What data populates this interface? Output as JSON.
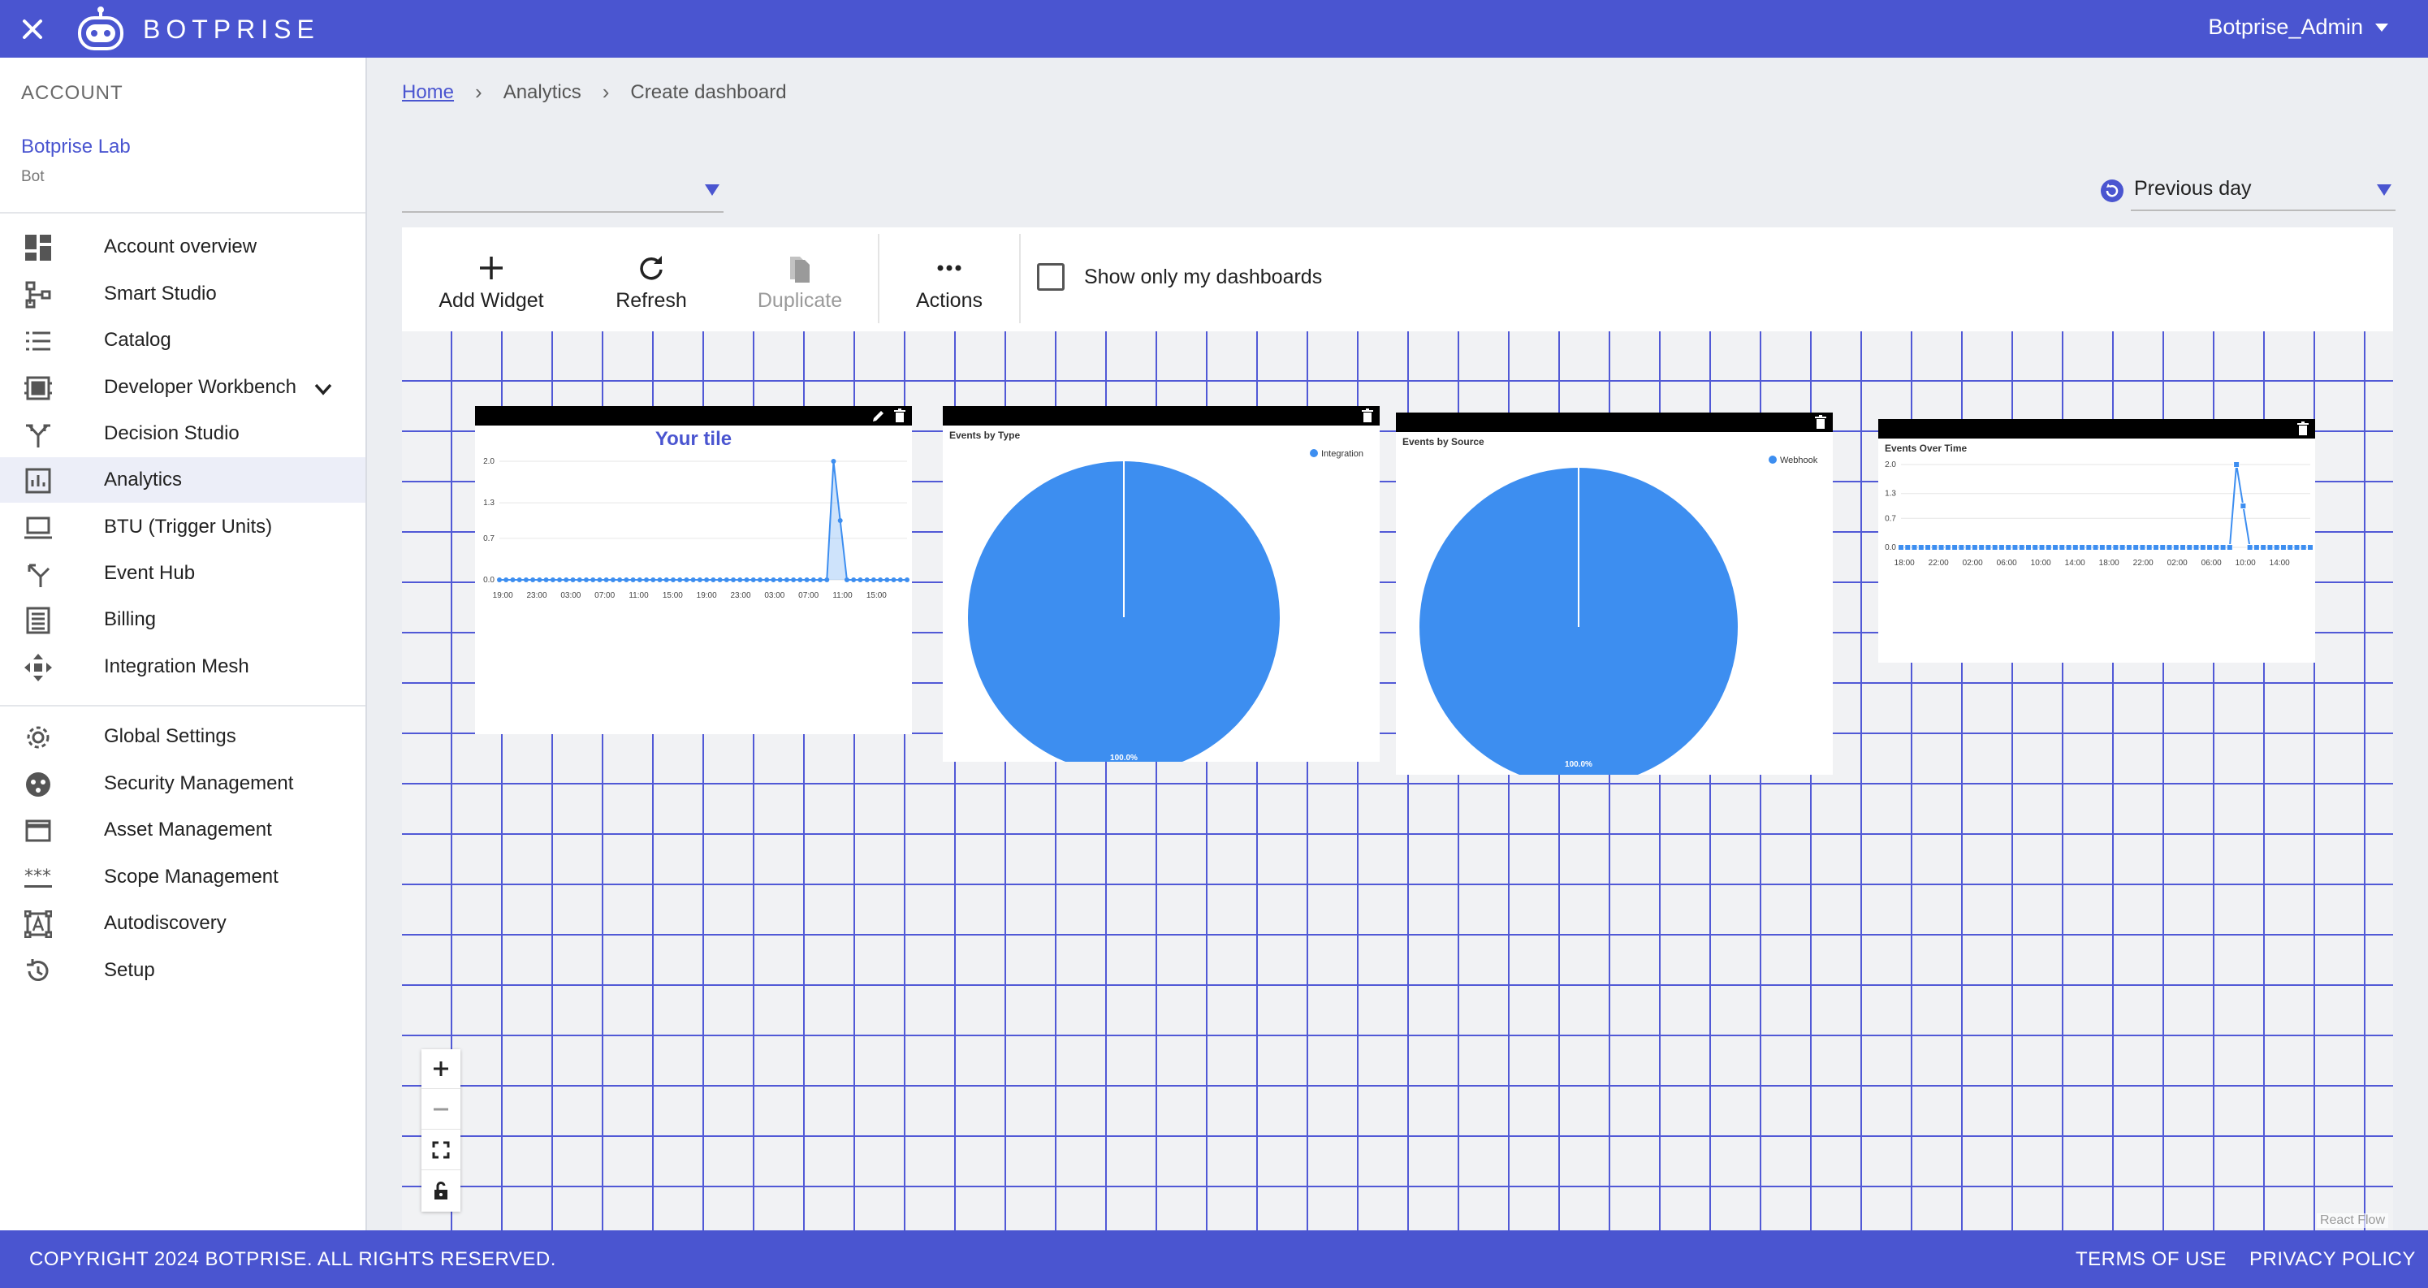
{
  "header": {
    "brand": "BOTPRISE",
    "user": "Botprise_Admin"
  },
  "sidebar": {
    "section_label": "ACCOUNT",
    "account_name": "Botprise Lab",
    "account_type": "Bot",
    "items": [
      {
        "label": "Account overview",
        "icon": "dashboard-icon"
      },
      {
        "label": "Smart Studio",
        "icon": "workflow-icon"
      },
      {
        "label": "Catalog",
        "icon": "list-icon"
      },
      {
        "label": "Developer Workbench",
        "icon": "workbench-icon"
      },
      {
        "label": "Decision Studio",
        "icon": "fork-icon"
      },
      {
        "label": "Analytics",
        "icon": "bar-chart-icon"
      },
      {
        "label": "BTU (Trigger Units)",
        "icon": "laptop-icon"
      },
      {
        "label": "Event Hub",
        "icon": "merge-icon"
      },
      {
        "label": "Billing",
        "icon": "receipt-icon"
      },
      {
        "label": "Integration Mesh",
        "icon": "move-icon"
      },
      {
        "label": "Global Settings",
        "icon": "gear-icon"
      },
      {
        "label": "Security Management",
        "icon": "security-icon"
      },
      {
        "label": "Asset Management",
        "icon": "window-icon"
      },
      {
        "label": "Scope Management",
        "icon": "asterisk-icon"
      },
      {
        "label": "Autodiscovery",
        "icon": "scan-icon"
      },
      {
        "label": "Setup",
        "icon": "restore-icon"
      }
    ]
  },
  "breadcrumb": {
    "home": "Home",
    "analytics": "Analytics",
    "current": "Create dashboard"
  },
  "filters": {
    "dashboard_select": "",
    "period": "Previous day"
  },
  "toolbar": {
    "add_widget": "Add Widget",
    "refresh": "Refresh",
    "duplicate": "Duplicate",
    "actions": "Actions",
    "show_mine": "Show only my dashboards"
  },
  "colors": {
    "primary": "#4a55d0",
    "chart_blue": "#3d8ef0",
    "grid_blue": "#5159d6"
  },
  "widgets": {
    "tile1": {
      "title": "Your tile"
    },
    "tile2": {
      "title": "Events by Type",
      "legend": "Integration",
      "slice_label": "100.0%"
    },
    "tile3": {
      "title": "Events by Source",
      "legend": "Webhook",
      "slice_label": "100.0%"
    },
    "tile4": {
      "title": "Events Over Time"
    }
  },
  "chart_data": [
    {
      "type": "area",
      "title": "Your tile",
      "yticks": [
        "0.0",
        "0.7",
        "1.3",
        "2.0"
      ],
      "ylim": [
        0,
        2
      ],
      "xticks": [
        "19:00",
        "23:00",
        "03:00",
        "07:00",
        "11:00",
        "15:00",
        "19:00",
        "23:00",
        "03:00",
        "07:00",
        "11:00",
        "15:00"
      ],
      "values": [
        0,
        0,
        0,
        0,
        0,
        0,
        0,
        0,
        0,
        0,
        0,
        0,
        0,
        0,
        0,
        0,
        0,
        0,
        0,
        0,
        0,
        0,
        0,
        0,
        0,
        0,
        0,
        0,
        0,
        0,
        0,
        0,
        0,
        0,
        0,
        0,
        0,
        0,
        0,
        0,
        0,
        0,
        0,
        0,
        0,
        0,
        0,
        0,
        0,
        0,
        2,
        1,
        0,
        0,
        0,
        0,
        0,
        0,
        0,
        0,
        0,
        0
      ]
    },
    {
      "type": "pie",
      "title": "Events by Type",
      "slices": [
        {
          "label": "Integration",
          "value": 100.0
        }
      ]
    },
    {
      "type": "pie",
      "title": "Events by Source",
      "slices": [
        {
          "label": "Webhook",
          "value": 100.0
        }
      ]
    },
    {
      "type": "line",
      "title": "Events Over Time",
      "yticks": [
        "0.0",
        "0.7",
        "1.3",
        "2.0"
      ],
      "ylim": [
        0,
        2
      ],
      "xticks": [
        "18:00",
        "22:00",
        "02:00",
        "06:00",
        "10:00",
        "14:00",
        "18:00",
        "22:00",
        "02:00",
        "06:00",
        "10:00",
        "14:00"
      ],
      "values": [
        0,
        0,
        0,
        0,
        0,
        0,
        0,
        0,
        0,
        0,
        0,
        0,
        0,
        0,
        0,
        0,
        0,
        0,
        0,
        0,
        0,
        0,
        0,
        0,
        0,
        0,
        0,
        0,
        0,
        0,
        0,
        0,
        0,
        0,
        0,
        0,
        0,
        0,
        0,
        0,
        0,
        0,
        0,
        0,
        0,
        0,
        0,
        0,
        0,
        0,
        2,
        1,
        0,
        0,
        0,
        0,
        0,
        0,
        0,
        0,
        0,
        0
      ]
    }
  ],
  "canvas": {
    "attribution": "React Flow"
  },
  "footer": {
    "copyright": "COPYRIGHT 2024 BOTPRISE. ALL RIGHTS RESERVED.",
    "terms": "TERMS OF USE",
    "privacy": "PRIVACY POLICY"
  }
}
